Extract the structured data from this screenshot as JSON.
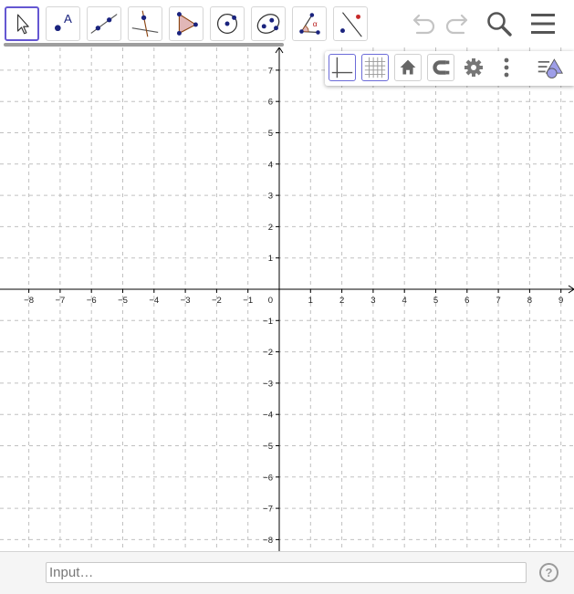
{
  "toolbar": {
    "tools": [
      {
        "name": "Move",
        "icon": "move-arrow-icon"
      },
      {
        "name": "Point",
        "icon": "point-icon"
      },
      {
        "name": "Line",
        "icon": "line-icon"
      },
      {
        "name": "Perpendicular Line",
        "icon": "perpendicular-line-icon"
      },
      {
        "name": "Polygon",
        "icon": "polygon-icon"
      },
      {
        "name": "Circle with Center through Point",
        "icon": "circle-center-point-icon"
      },
      {
        "name": "Ellipse",
        "icon": "ellipse-icon"
      },
      {
        "name": "Angle",
        "icon": "angle-icon"
      },
      {
        "name": "Reflect about Line",
        "icon": "reflect-line-icon"
      }
    ],
    "point_tool_letter": "A",
    "angle_tool_letter": "α",
    "header_icons": [
      "undo-icon",
      "redo-icon",
      "search-icon",
      "menu-icon"
    ]
  },
  "style_bar": {
    "icons": [
      "axes-toggle-icon",
      "grid-toggle-icon",
      "home-icon",
      "point-capturing-icon",
      "settings-gear-icon",
      "more-options-icon",
      "toggle-style-bar-icon"
    ]
  },
  "graphics": {
    "x_ticks": [
      "−8",
      "−7",
      "−6",
      "−5",
      "−4",
      "−3",
      "−2",
      "−1",
      "1",
      "2",
      "3",
      "4",
      "5",
      "6",
      "7",
      "8",
      "9"
    ],
    "y_ticks_positive": [
      "1",
      "2",
      "3",
      "4",
      "5",
      "6",
      "7",
      "8"
    ],
    "y_ticks_negative": [
      "−1",
      "−2",
      "−3",
      "−4",
      "−5",
      "−6",
      "−7",
      "−8",
      "−9"
    ],
    "origin_label": "0",
    "x_range": [
      -9,
      9
    ],
    "y_range": [
      -9.8,
      8.8
    ],
    "grid": true,
    "grid_style": "dashed"
  },
  "input_bar": {
    "placeholder": "Input…",
    "help_label": "?"
  },
  "colors": {
    "accent": "#6557d2",
    "point": "#1565c0",
    "polygon_fill": "#e1b7b7",
    "grid_line": "#c0c0c0",
    "axis": "#000000"
  }
}
